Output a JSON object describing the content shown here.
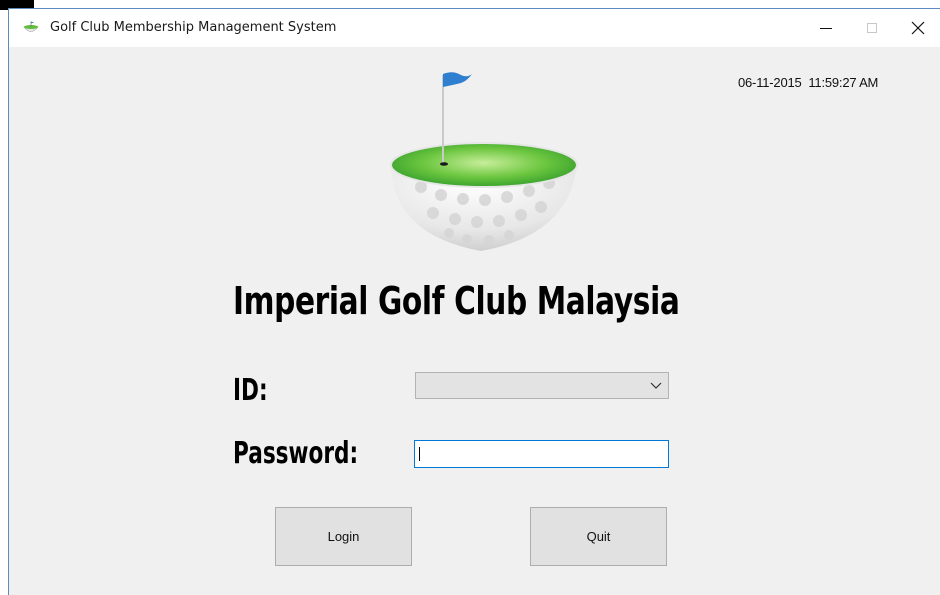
{
  "window": {
    "title": "Golf Club Membership Management System",
    "controls": {
      "minimize": "–",
      "maximize": "□",
      "close": "✕"
    }
  },
  "header": {
    "datetime": "06-11-2015  11:59:27 AM",
    "club_name": "Imperial Golf Club Malaysia",
    "logo_icon": "golf-ball-cup-flag-icon"
  },
  "form": {
    "id_label": "ID:",
    "id_value": "",
    "password_label": "Password:",
    "password_value": ""
  },
  "buttons": {
    "login": "Login",
    "quit": "Quit"
  },
  "colors": {
    "accent_focus": "#0078d7",
    "green_top": "#5fbf3c",
    "flag_blue": "#2f7fd1"
  }
}
